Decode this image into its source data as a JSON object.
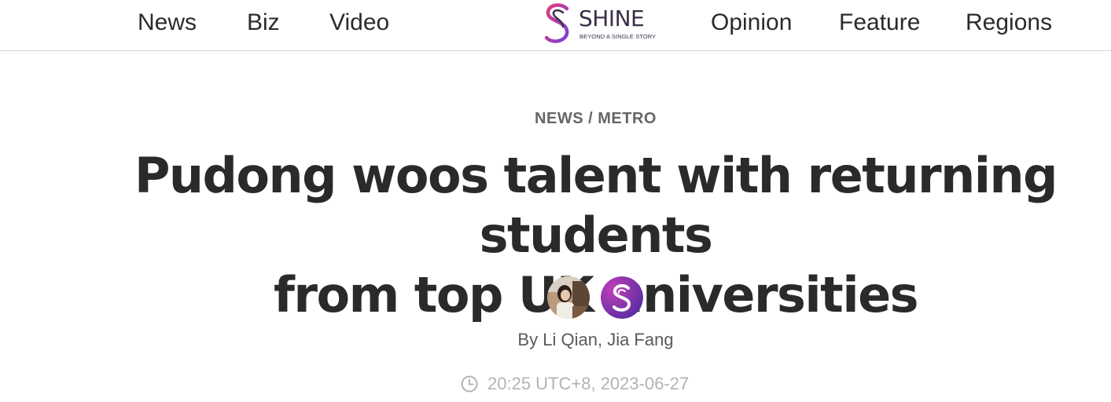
{
  "nav": {
    "left": [
      "News",
      "Biz",
      "Video"
    ],
    "right": [
      "Opinion",
      "Feature",
      "Regions"
    ]
  },
  "logo": {
    "wordmark": "SHINE",
    "tagline": "BEYOND A SINGLE STORY",
    "icon": "shine-s-logo-icon",
    "brand_colors": [
      "#e53b7c",
      "#7b3fd6",
      "#3a2f4a"
    ]
  },
  "article": {
    "section": "NEWS",
    "separator": "/",
    "subsection": "METRO",
    "headline_line1": "Pudong woos talent with returning students",
    "headline_line2": "from top UK universities",
    "byline_prefix": "By",
    "authors": [
      "Li Qian",
      "Jia Fang"
    ],
    "author_separator": ",",
    "timestamp": "20:25 UTC+8, 2023-06-27",
    "clock_icon": "clock-icon"
  },
  "colors": {
    "text_dark": "#2a2a2a",
    "category_gray": "#666666",
    "byline_gray": "#5a5a5a",
    "date_gray": "#b3b3b3",
    "divider": "#d4d4d4"
  }
}
